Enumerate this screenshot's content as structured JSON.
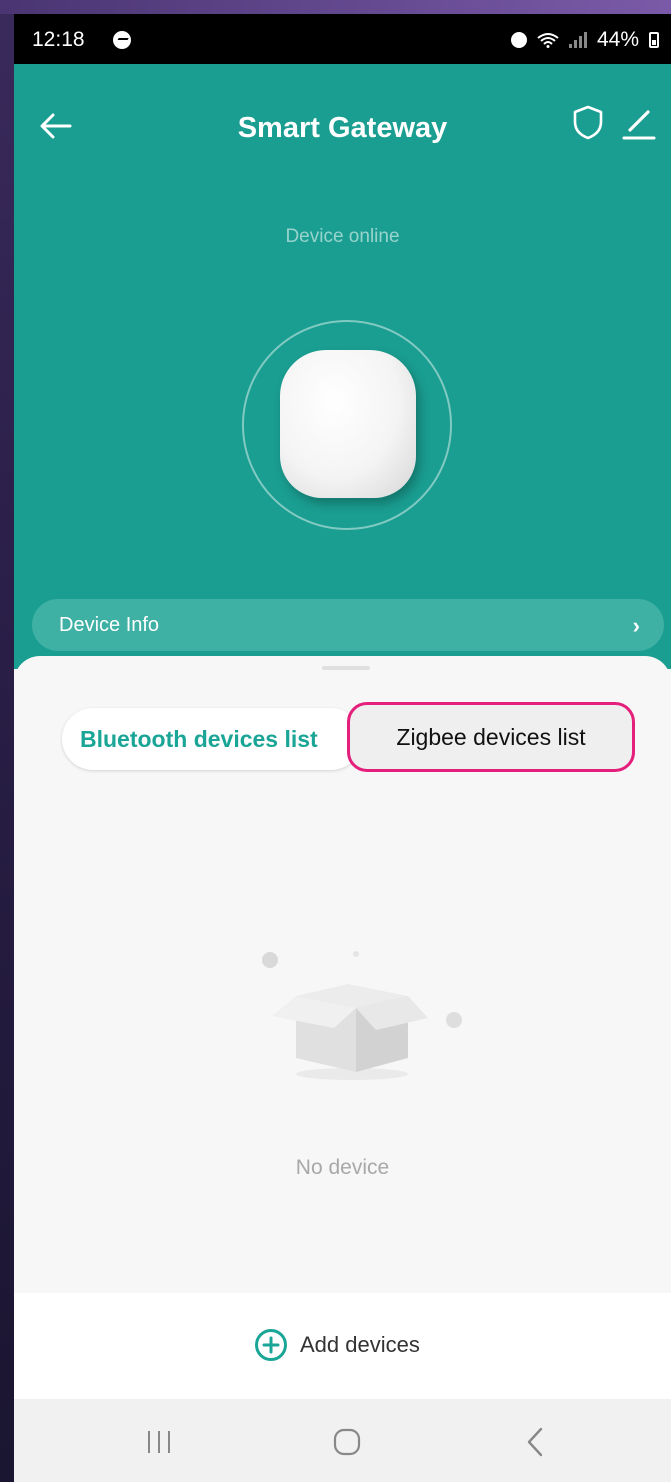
{
  "status_bar": {
    "time": "12:18",
    "battery": "44%"
  },
  "header": {
    "title": "Smart Gateway",
    "status": "Device online",
    "device_info_label": "Device Info"
  },
  "tabs": {
    "bluetooth": "Bluetooth devices list",
    "zigbee": "Zigbee devices list"
  },
  "empty_state": {
    "text": "No device"
  },
  "footer": {
    "add_label": "Add devices"
  },
  "colors": {
    "teal": "#1a9e91",
    "accent_text": "#1ba596",
    "highlight": "#e4207c"
  },
  "icons": [
    "back-arrow-icon",
    "shield-icon",
    "edit-pencil-icon",
    "chevron-right-icon",
    "plus-circle-icon",
    "empty-box-icon",
    "recents-icon",
    "home-icon",
    "back-icon"
  ]
}
